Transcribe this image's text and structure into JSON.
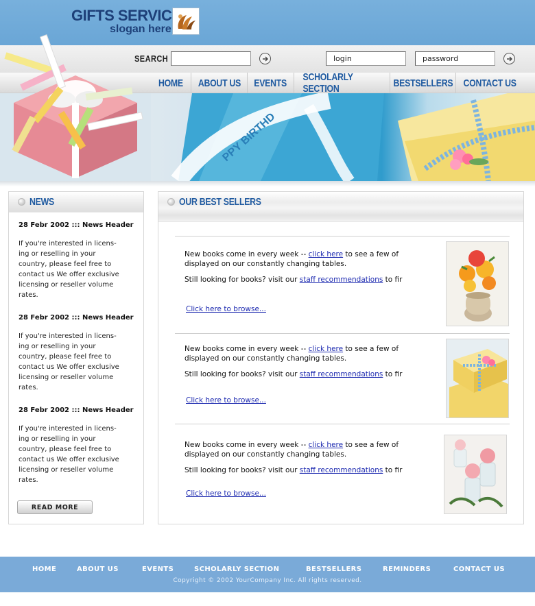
{
  "header": {
    "title_line1": "GIFTS SERVICE",
    "title_line2": "slogan here",
    "brand_color": "#1d3f78",
    "band_color": "#6aa6d6"
  },
  "search": {
    "label": "SEARCH",
    "value": "",
    "go_icon": "arrow-right-circle-icon"
  },
  "auth": {
    "login_value": "login",
    "password_value": "password",
    "go_icon": "arrow-right-circle-icon"
  },
  "nav": {
    "color": "#1f5aa0",
    "items": [
      "HOME",
      "ABOUT US",
      "EVENTS",
      "SCHOLARLY SECTION",
      "BESTSELLERS",
      "CONTACT US"
    ]
  },
  "news": {
    "title": "NEWS",
    "entries": [
      {
        "date": "28 Febr 2002 ::: News Header",
        "body_lines": [
          "If you're interested in licens-",
          "ing or reselling  in your",
          "country, please feel free to",
          "contact us We offer exclusive",
          "licensing or reseller volume",
          "rates."
        ]
      },
      {
        "date": "28 Febr 2002 ::: News Header",
        "body_lines": [
          "If you're interested in licens-",
          "ing or reselling  in your",
          "country, please feel free to",
          "contact us We offer exclusive",
          "licensing or reseller volume",
          "rates."
        ]
      },
      {
        "date": "28 Febr 2002 ::: News Header",
        "body_lines": [
          "If you're interested in licens-",
          "ing or reselling  in your",
          "country, please feel free to",
          "contact us We offer exclusive",
          "licensing or reseller volume",
          "rates."
        ]
      }
    ],
    "read_more_label": "READ MORE"
  },
  "bestsellers": {
    "title": "OUR BEST SELLERS",
    "items": [
      {
        "line1_pre": "New books come in every week -- ",
        "line1_link": "click here",
        "line1_post": " to see a few of",
        "line2": "displayed on our constantly changing tables.",
        "line3_pre": "Still looking for books? visit our ",
        "line3_link": "staff recommendations",
        "line3_post": " to fir",
        "browse_label": "Click here to browse...",
        "image": "flowers-in-vase-image"
      },
      {
        "line1_pre": "New books come in every week -- ",
        "line1_link": "click here",
        "line1_post": " to see a few of",
        "line2": "displayed on our constantly changing tables.",
        "line3_pre": "Still looking for books? visit our ",
        "line3_link": "staff recommendations",
        "line3_post": " to fir",
        "browse_label": "Click here to browse...",
        "image": "yellow-gift-boxes-image"
      },
      {
        "line1_pre": "New books come in every week -- ",
        "line1_link": "click here",
        "line1_post": " to see a few of",
        "line2": "displayed on our constantly changing tables.",
        "line3_pre": "Still looking for books? visit our ",
        "line3_link": "staff recommendations",
        "line3_post": " to fir",
        "browse_label": "Click here to browse...",
        "image": "roses-in-glasses-image"
      }
    ]
  },
  "footer": {
    "links": [
      "HOME",
      "ABOUT US",
      "EVENTS",
      "SCHOLARLY SECTION",
      "BESTSELLERS",
      "REMINDERS",
      "CONTACT US"
    ],
    "copyright": "Copyright © 2002 YourCompany Inc. All rights reserved.",
    "background": "#7aaad8"
  }
}
